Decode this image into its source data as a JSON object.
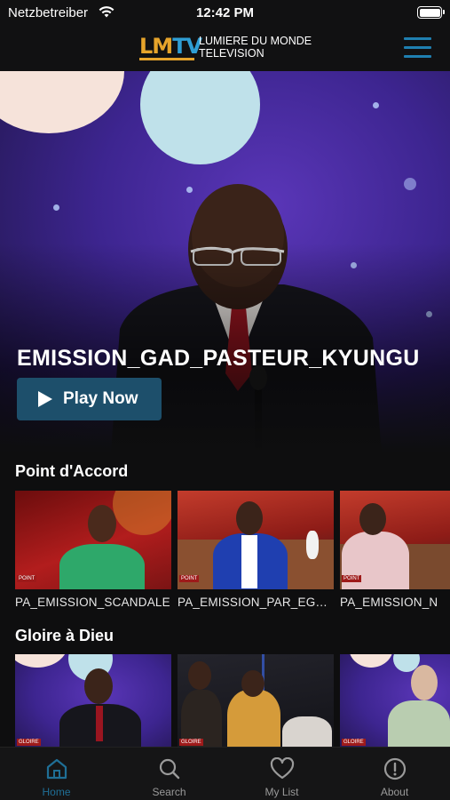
{
  "status_bar": {
    "carrier": "Netzbetreiber",
    "time": "12:42 PM"
  },
  "header": {
    "logo": "LMTV",
    "brand_line1": "LUMIERE DU MONDE",
    "brand_line2": "TELEVISION",
    "menu_icon": "hamburger-menu-icon",
    "accent_color": "#1f7fb0"
  },
  "hero": {
    "title": "EMISSION_GAD_PASTEUR_KYUNGU",
    "play_label": "Play Now",
    "button_color": "#1d4f6b"
  },
  "sections": [
    {
      "title": "Point d'Accord",
      "items": [
        {
          "label": "PA_EMISSION_SCANDALE"
        },
        {
          "label": "PA_EMISSION_PAR_EGLISE"
        },
        {
          "label": "PA_EMISSION_N"
        }
      ]
    },
    {
      "title": "Gloire à Dieu",
      "items": [
        {
          "label": ""
        },
        {
          "label": ""
        },
        {
          "label": ""
        }
      ]
    }
  ],
  "tabbar": {
    "active_color": "#1f6f96",
    "tabs": [
      {
        "label": "Home",
        "icon": "home-icon"
      },
      {
        "label": "Search",
        "icon": "search-icon"
      },
      {
        "label": "My List",
        "icon": "heart-icon"
      },
      {
        "label": "About",
        "icon": "info-icon"
      }
    ]
  }
}
